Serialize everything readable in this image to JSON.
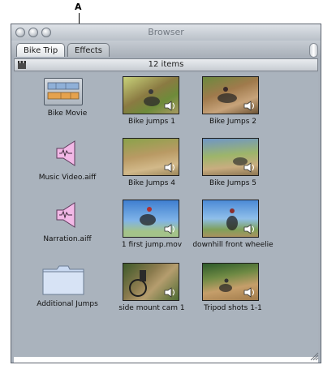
{
  "callout": {
    "label": "A"
  },
  "window": {
    "title": "Browser"
  },
  "tabs": [
    {
      "label": "Bike Trip"
    },
    {
      "label": "Effects"
    }
  ],
  "status": {
    "count": "12 items"
  },
  "items": [
    {
      "label": "Bike Movie",
      "kind": "sequence"
    },
    {
      "label": "Music Video.aiff",
      "kind": "audio"
    },
    {
      "label": "Narration.aiff",
      "kind": "audio"
    },
    {
      "label": "Additional Jumps",
      "kind": "bin"
    },
    {
      "label": "Bike jumps 1",
      "kind": "clip"
    },
    {
      "label": "Bike Jumps 2",
      "kind": "clip"
    },
    {
      "label": "Bike Jumps 4",
      "kind": "clip"
    },
    {
      "label": "Bike Jumps 5",
      "kind": "clip"
    },
    {
      "label": "1 first jump.mov",
      "kind": "clip"
    },
    {
      "label": "downhill front wheelie",
      "kind": "clip"
    },
    {
      "label": "side mount cam 1",
      "kind": "clip"
    },
    {
      "label": "Tripod shots 1-1",
      "kind": "clip"
    }
  ],
  "colors": {
    "window_bg": "#a9b1bb",
    "accent": "#aab3bd"
  }
}
